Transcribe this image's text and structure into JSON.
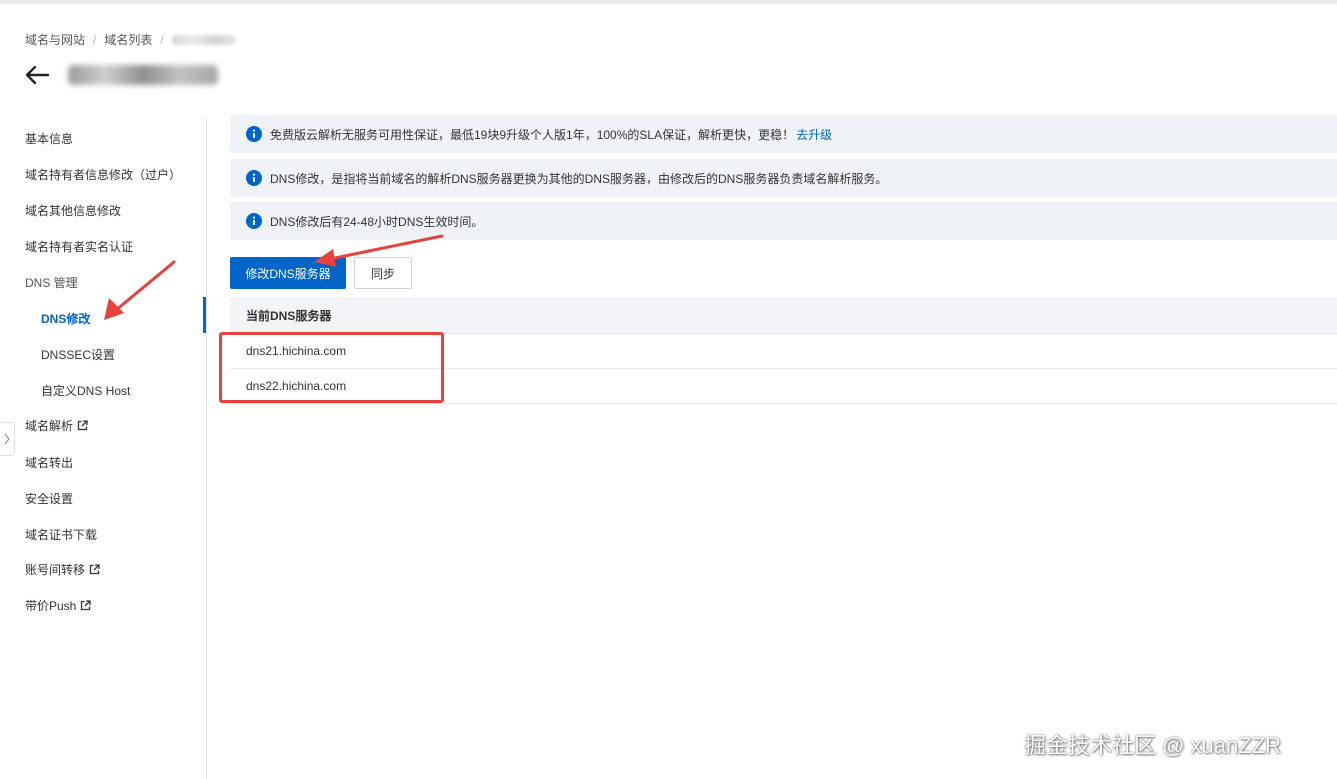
{
  "breadcrumb": {
    "item1": "域名与网站",
    "item2": "域名列表",
    "separator": "/"
  },
  "sidebar": {
    "items": [
      {
        "label": "基本信息"
      },
      {
        "label": "域名持有者信息修改（过户）"
      },
      {
        "label": "域名其他信息修改"
      },
      {
        "label": "域名持有者实名认证"
      },
      {
        "label": "DNS 管理"
      },
      {
        "label": "DNS修改"
      },
      {
        "label": "DNSSEC设置"
      },
      {
        "label": "自定义DNS Host"
      },
      {
        "label": "域名解析"
      },
      {
        "label": "域名转出"
      },
      {
        "label": "安全设置"
      },
      {
        "label": "域名证书下载"
      },
      {
        "label": "账号间转移"
      },
      {
        "label": "带价Push"
      }
    ]
  },
  "notices": [
    {
      "text": "免费版云解析无服务可用性保证，最低19块9升级个人版1年，100%的SLA保证，解析更快，更稳！",
      "link": "去升级"
    },
    {
      "text": "DNS修改，是指将当前域名的解析DNS服务器更换为其他的DNS服务器，由修改后的DNS服务器负责域名解析服务。"
    },
    {
      "text": "DNS修改后有24-48小时DNS生效时间。"
    }
  ],
  "actions": {
    "modify_dns": "修改DNS服务器",
    "sync": "同步"
  },
  "dns_table": {
    "header": "当前DNS服务器",
    "rows": [
      "dns21.hichina.com",
      "dns22.hichina.com"
    ]
  },
  "watermark": "掘金技术社区 @ xuanZZR",
  "colors": {
    "primary": "#0064c8",
    "notice_bg": "#eff3f8",
    "annotation_red": "#e8403c"
  }
}
